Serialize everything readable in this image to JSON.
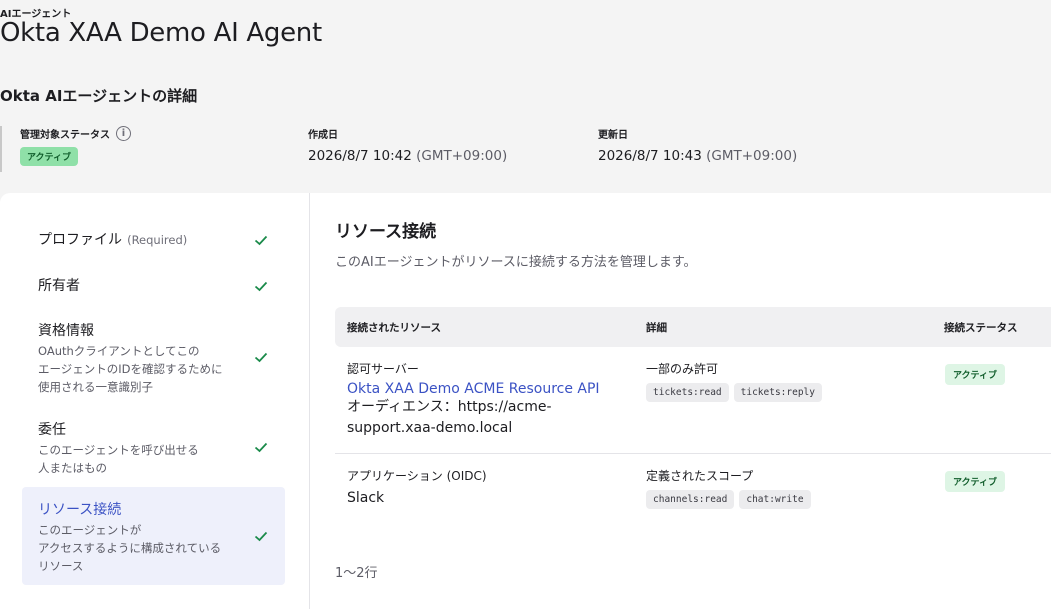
{
  "header": {
    "eyebrow": "AIエージェント",
    "title": "Okta XAA Demo AI Agent",
    "section_title": "Okta AIエージェントの詳細"
  },
  "meta": {
    "status_label": "管理対象ステータス",
    "status_value": "アクティブ",
    "created_label": "作成日",
    "created_value": "2026/8/7 10:42",
    "created_tz": "(GMT+09:00)",
    "updated_label": "更新日",
    "updated_value": "2026/8/7 10:43",
    "updated_tz": "(GMT+09:00)"
  },
  "nav": {
    "items": [
      {
        "label": "プロファイル",
        "req": "(Required)",
        "desc": ""
      },
      {
        "label": "所有者",
        "desc": ""
      },
      {
        "label": "資格情報",
        "desc1": "OAuthクライアントとしてこの",
        "desc2": "エージェントのIDを確認するために",
        "desc3": "使用される一意識別子"
      },
      {
        "label": "委任",
        "desc1": "このエージェントを呼び出せる",
        "desc2": "人またはもの"
      },
      {
        "label": "リソース接続",
        "desc1": "このエージェントが",
        "desc2": "アクセスするように構成されている",
        "desc3": "リソース"
      }
    ]
  },
  "content": {
    "title": "リソース接続",
    "subtitle": "このAIエージェントがリソースに接続する方法を管理します。",
    "columns": [
      "接続されたリソース",
      "詳細",
      "接続ステータス"
    ],
    "rows": [
      {
        "type": "認可サーバー",
        "name": "Okta XAA Demo ACME Resource API",
        "audience1": "オーディエンス：https://acme-",
        "audience2": "support.xaa-demo.local",
        "detail_title": "一部のみ許可",
        "scopes": [
          "tickets:read",
          "tickets:reply"
        ],
        "status": "アクティブ"
      },
      {
        "type": "アプリケーション (OIDC)",
        "name": "Slack",
        "detail_title": "定義されたスコープ",
        "scopes": [
          "channels:read",
          "chat:write"
        ],
        "status": "アクティブ"
      }
    ],
    "pager": "1〜2行"
  },
  "colors": {
    "accent": "#3b52c4",
    "success": "#1a8a4a",
    "badge_bg": "#8fe0a8"
  }
}
